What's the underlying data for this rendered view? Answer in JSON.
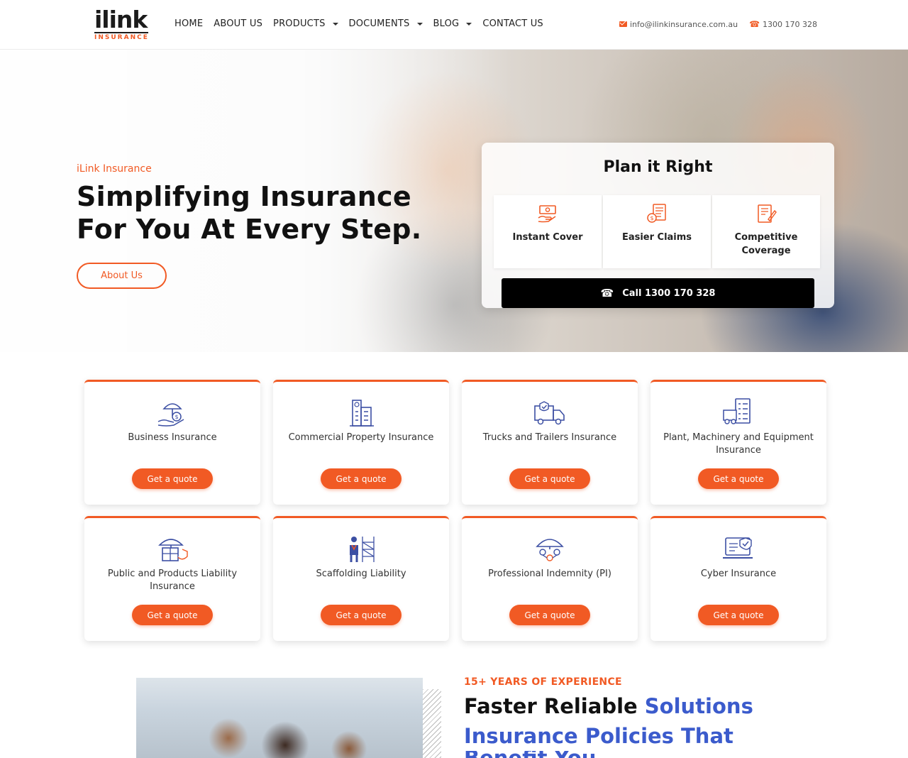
{
  "brand": {
    "name": "ilink",
    "sub": "INSURANCE"
  },
  "nav": [
    {
      "label": "HOME",
      "dropdown": false
    },
    {
      "label": "ABOUT US",
      "dropdown": false
    },
    {
      "label": "PRODUCTS",
      "dropdown": true
    },
    {
      "label": "DOCUMENTS",
      "dropdown": true
    },
    {
      "label": "BLOG",
      "dropdown": true
    },
    {
      "label": "CONTACT US",
      "dropdown": false
    }
  ],
  "contact": {
    "email": "info@ilinkinsurance.com.au",
    "phone": "1300 170 328"
  },
  "hero": {
    "kicker": "iLink Insurance",
    "title_line1": "Simplifying Insurance",
    "title_line2": "For You At Every Step.",
    "cta": "About Us"
  },
  "plan": {
    "title": "Plan it Right",
    "features": [
      {
        "label": "Instant Cover",
        "icon": "cash-hand-icon"
      },
      {
        "label": "Easier Claims",
        "icon": "claims-document-icon"
      },
      {
        "label": "Competitive Coverage",
        "icon": "contract-pen-icon"
      }
    ],
    "call_label": "Call 1300 170 328"
  },
  "services": [
    {
      "label": "Business Insurance",
      "icon": "umbrella-hand-icon",
      "cta": "Get a quote"
    },
    {
      "label": "Commercial Property Insurance",
      "icon": "building-icon",
      "cta": "Get a quote"
    },
    {
      "label": "Trucks and Trailers Insurance",
      "icon": "truck-icon",
      "cta": "Get a quote"
    },
    {
      "label": "Plant, Machinery and Equipment Insurance",
      "icon": "machinery-checklist-icon",
      "cta": "Get a quote"
    },
    {
      "label": "Public and Products Liability Insurance",
      "icon": "umbrella-box-icon",
      "cta": "Get a quote"
    },
    {
      "label": "Scaffolding Liability",
      "icon": "scaffold-worker-icon",
      "cta": "Get a quote"
    },
    {
      "label": "Professional Indemnity (PI)",
      "icon": "umbrella-people-icon",
      "cta": "Get a quote"
    },
    {
      "label": "Cyber Insurance",
      "icon": "laptop-shield-icon",
      "cta": "Get a quote"
    }
  ],
  "experience": {
    "kicker": "15+ YEARS OF EXPERIENCE",
    "title_plain": "Faster Reliable ",
    "title_blue": "Solutions",
    "title_line2": "Insurance Policies That",
    "title_line3": "Benefit You"
  },
  "colors": {
    "accent": "#f15a24",
    "blue": "#3b5bcc",
    "icon_blue": "#3c4fa3",
    "dark": "#111111"
  }
}
